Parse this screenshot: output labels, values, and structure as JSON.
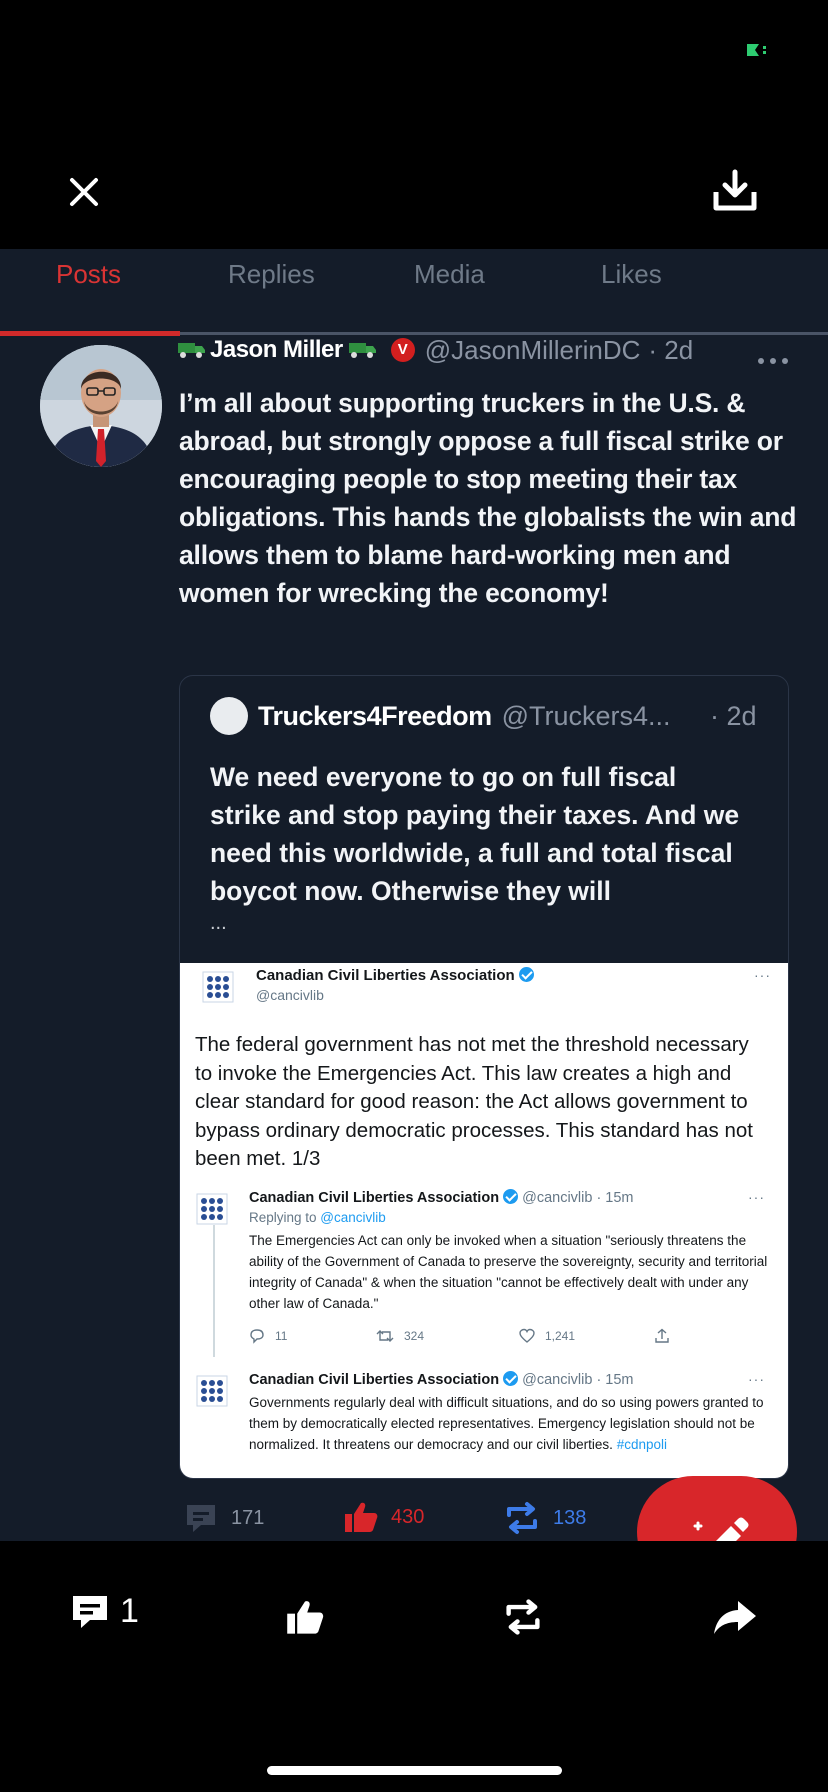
{
  "viewer": {
    "status_icon": "battery-icon",
    "close_icon": "close-icon",
    "download_icon": "download-icon"
  },
  "tabs": [
    {
      "label": "Posts",
      "active": true
    },
    {
      "label": "Replies",
      "active": false
    },
    {
      "label": "Media",
      "active": false
    },
    {
      "label": "Likes",
      "active": false
    }
  ],
  "post": {
    "author_name": "Jason Miller",
    "author_badge": "V",
    "author_handle": "@JasonMillerinDC",
    "time": "· 2d",
    "text": "I’m all about supporting truckers in the U.S. & abroad, but strongly oppose a full fiscal strike or encouraging people to stop meeting their tax obligations. This hands the globalists the win and allows them to blame hard-working men and women for wrecking the economy!",
    "quote": {
      "name": "Truckers4Freedom",
      "handle": "@Truckers4...",
      "time": "· 2d",
      "text": "We need everyone to go on full fiscal strike and stop paying their taxes. And we need this worldwide, a full and total fiscal boycot now. Otherwise they will",
      "ellipsis": "..."
    },
    "embedded_screenshot": {
      "main": {
        "name": "Canadian Civil Liberties Association",
        "handle": "@cancivlib",
        "more": "···",
        "text": "The federal government has not met the threshold necessary to invoke the Emergencies Act. This law creates a high and clear standard for good reason: the Act allows government to bypass ordinary democratic processes. This standard has not been met. 1/3"
      },
      "reply1": {
        "name": "Canadian Civil Liberties Association",
        "meta": "@cancivlib · 15m",
        "more": "···",
        "replying_prefix": "Replying to ",
        "replying_handle": "@cancivlib",
        "text": "The Emergencies Act can only be invoked when a situation \"seriously threatens the ability of the Government of Canada to preserve the sovereignty, security and territorial integrity of Canada\" & when the situation \"cannot be effectively dealt with under any other law of Canada.\"",
        "replies": "11",
        "retweets": "324",
        "likes": "1,241"
      },
      "reply2": {
        "name": "Canadian Civil Liberties Association",
        "meta": "@cancivlib · 15m",
        "more": "···",
        "text": "Governments regularly deal with difficult situations, and do so using powers granted to them by democratically elected representatives. Emergency legislation should not be normalized. It threatens our democracy and our civil liberties.",
        "hashtag": "#cdnpoli"
      }
    },
    "actions": {
      "comments": "171",
      "likes": "430",
      "reposts": "138"
    }
  },
  "bottom_bar": {
    "comment_count": "1"
  },
  "colors": {
    "accent_red": "#d8262a",
    "panel_bg": "#141c29",
    "repost_blue": "#3d7be8"
  }
}
